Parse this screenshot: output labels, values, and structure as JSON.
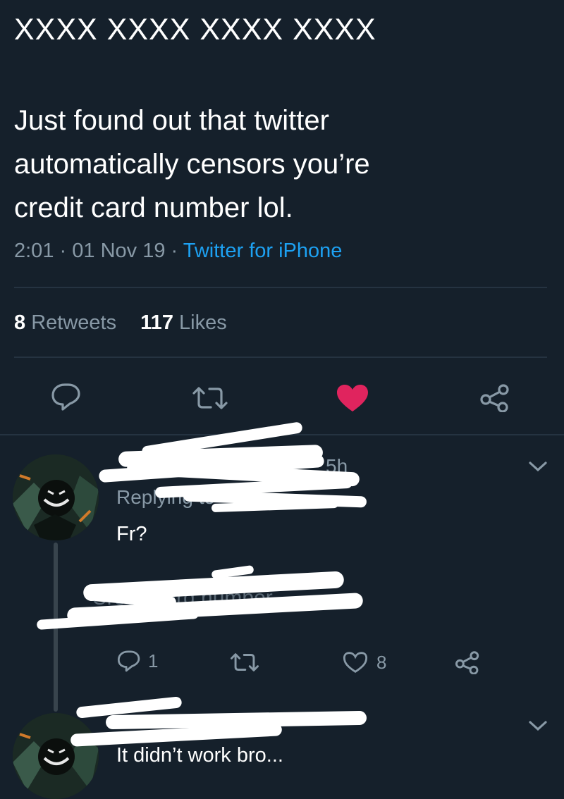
{
  "tweet": {
    "header_text": "XXXX XXXX XXXX XXXX",
    "text_line_1": "Just found out that twitter",
    "text_line_2": "automatically censors you’re",
    "text_line_3": "credit card number lol.",
    "time": "2:01",
    "date": "01 Nov 19",
    "sep": "·",
    "source": "Twitter for iPhone",
    "retweet_count": "8",
    "retweet_label": "Retweets",
    "like_count": "117",
    "like_label": "Likes"
  },
  "reply1": {
    "time_fragment": "5h",
    "replying_to": "Replying to",
    "text": "Fr?",
    "hidden_text": "Credit card number",
    "reply_count": "1",
    "like_count": "8"
  },
  "reply2": {
    "text": "It didn’t work bro..."
  },
  "colors": {
    "background": "#15202b",
    "muted": "#8899a6",
    "link": "#1da1f2",
    "like": "#e0245e",
    "divider": "#253341"
  },
  "icons": [
    "reply-icon",
    "retweet-icon",
    "like-icon",
    "share-icon",
    "chevron-down-icon",
    "avatar"
  ]
}
